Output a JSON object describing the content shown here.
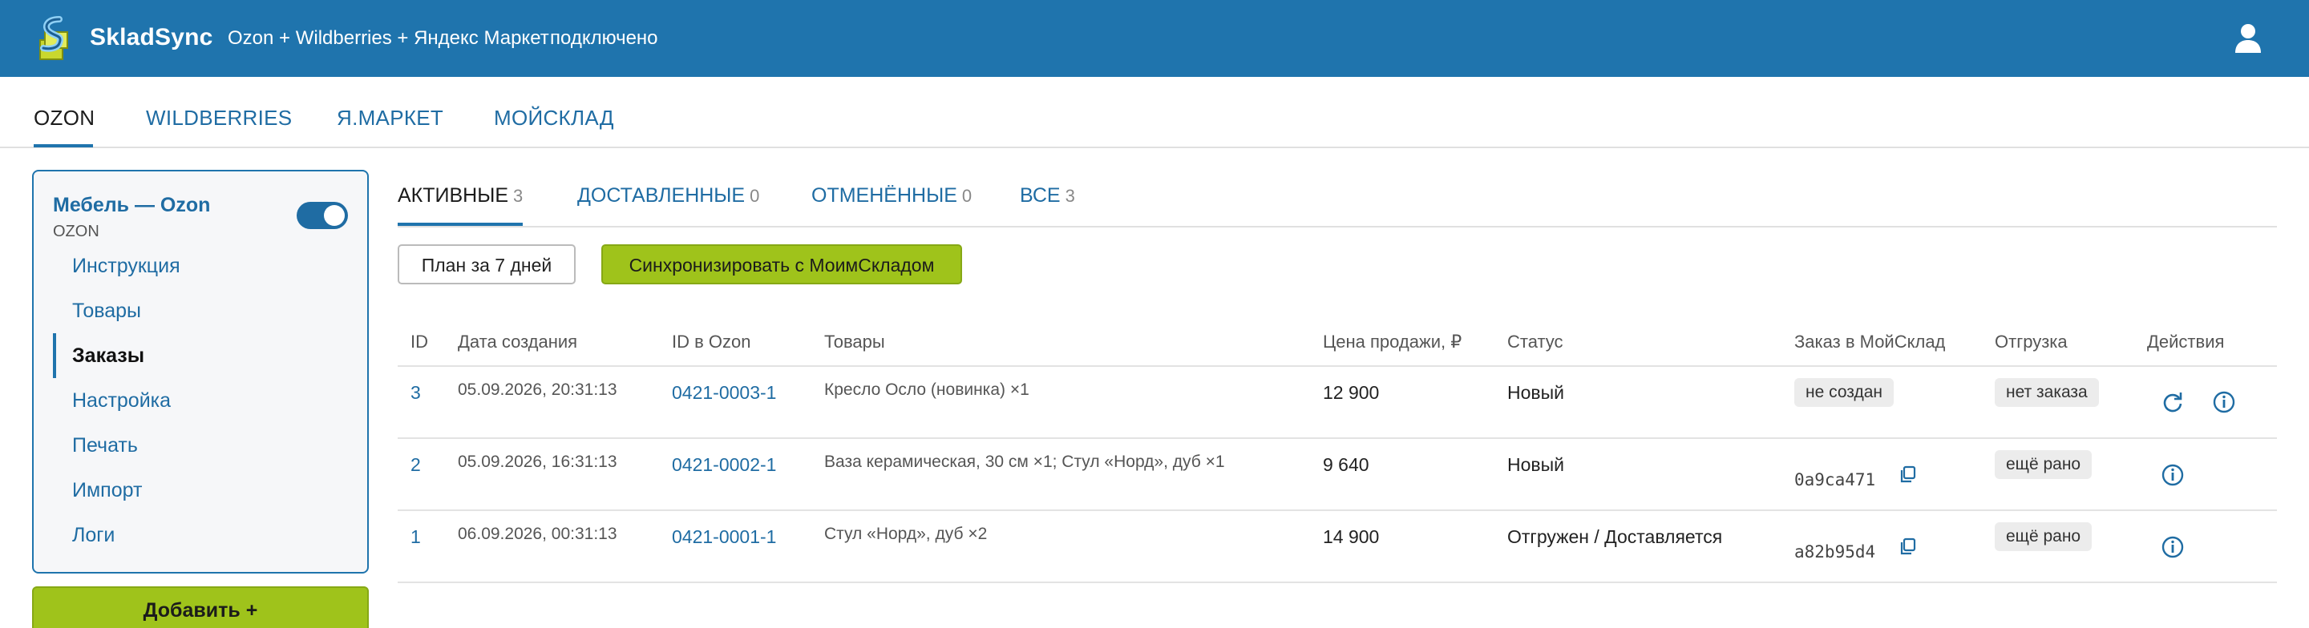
{
  "header": {
    "brand": "SkladSync",
    "subtitle": "Ozon + Wildberries + Яндекс Маркет",
    "connection": "подключено"
  },
  "marketplace_tabs": [
    {
      "label": "OZON",
      "active": true
    },
    {
      "label": "WILDBERRIES",
      "active": false
    },
    {
      "label": "Я.МАРКЕТ",
      "active": false
    },
    {
      "label": "МОЙСКЛАД",
      "active": false
    }
  ],
  "sidebar": {
    "shop_title": "Мебель — Ozon",
    "shop_subtitle": "OZON",
    "toggle_on": true,
    "items": [
      {
        "label": "Инструкция",
        "active": false
      },
      {
        "label": "Товары",
        "active": false
      },
      {
        "label": "Заказы",
        "active": true
      },
      {
        "label": "Настройка",
        "active": false
      },
      {
        "label": "Печать",
        "active": false
      },
      {
        "label": "Импорт",
        "active": false
      },
      {
        "label": "Логи",
        "active": false
      }
    ],
    "add_button": "Добавить +"
  },
  "status_tabs": [
    {
      "label": "АКТИВНЫЕ",
      "count": "3",
      "active": true
    },
    {
      "label": "ДОСТАВЛЕННЫЕ",
      "count": "0",
      "active": false
    },
    {
      "label": "ОТМЕНЁННЫЕ",
      "count": "0",
      "active": false
    },
    {
      "label": "ВСЕ",
      "count": "3",
      "active": false
    }
  ],
  "actions": {
    "plan_button": "План за 7 дней",
    "sync_button": "Синхронизировать с МоимСкладом"
  },
  "table": {
    "columns": [
      "ID",
      "Дата создания",
      "ID в Ozon",
      "Товары",
      "Цена продажи, ₽",
      "Статус",
      "Заказ в МойСклад",
      "Отгрузка",
      "Действия"
    ],
    "rows": [
      {
        "id": "3",
        "created": "05.09.2026, 20:31:13",
        "ozon_id": "0421-0003-1",
        "items": "Кресло Осло (новинка) ×1",
        "price": "12 900",
        "status": "Новый",
        "ms_order": "не создан",
        "ms_order_badge": true,
        "shipment": "нет заказа",
        "actions": [
          "refresh-icon",
          "info-icon"
        ]
      },
      {
        "id": "2",
        "created": "05.09.2026, 16:31:13",
        "ozon_id": "0421-0002-1",
        "items": "Ваза керамическая, 30 см ×1; Стул «Норд», дуб ×1",
        "price": "9 640",
        "status": "Новый",
        "ms_order": "0a9ca471",
        "ms_order_badge": false,
        "shipment": "ещё рано",
        "actions": [
          "info-icon"
        ]
      },
      {
        "id": "1",
        "created": "06.09.2026, 00:31:13",
        "ozon_id": "0421-0001-1",
        "items": "Стул «Норд», дуб ×2",
        "price": "14 900",
        "status": "Отгружен / Доставляется",
        "ms_order": "a82b95d4",
        "ms_order_badge": false,
        "shipment": "ещё рано",
        "actions": [
          "info-icon"
        ]
      }
    ]
  },
  "colors": {
    "primary": "#1f74ad",
    "link": "#1f6ca3",
    "accent_green": "#9fc31b"
  }
}
